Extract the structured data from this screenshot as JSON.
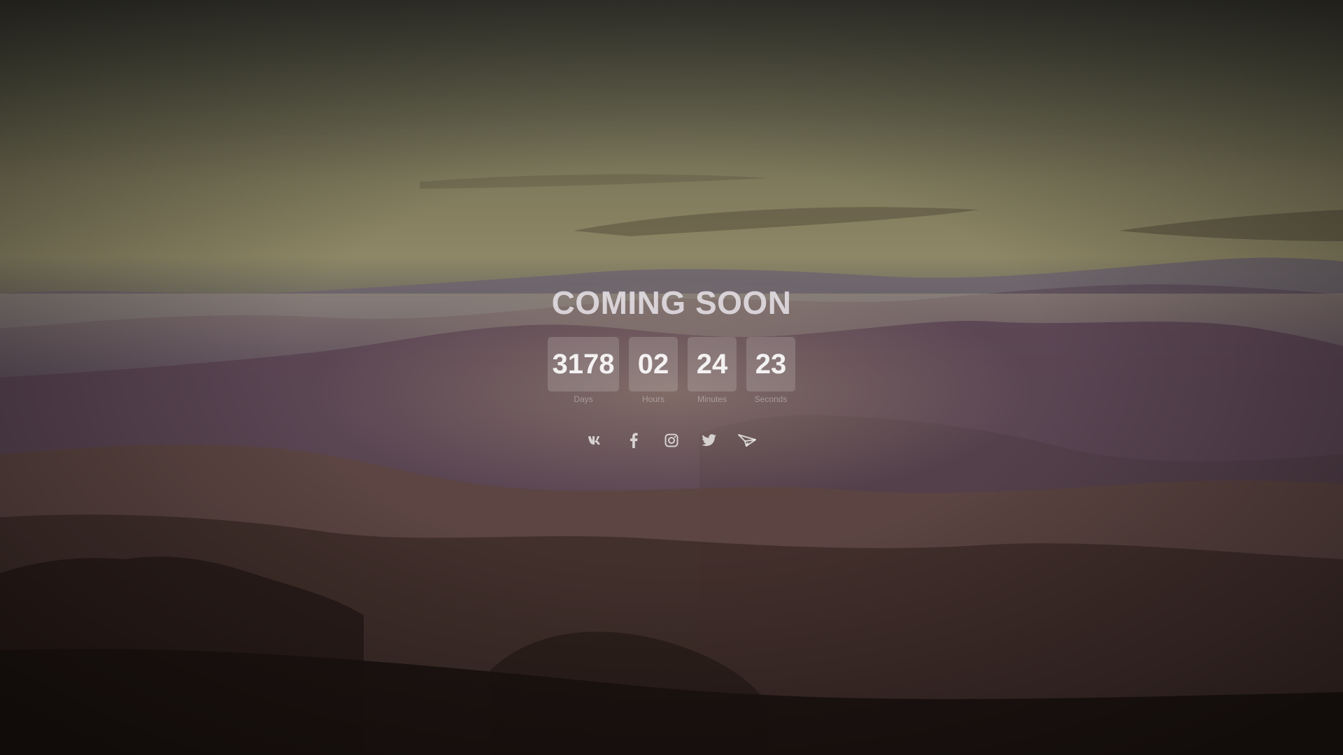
{
  "page": {
    "title": "COMING SOON"
  },
  "countdown": [
    {
      "value": "3178",
      "label": "Days"
    },
    {
      "value": "02",
      "label": "Hours"
    },
    {
      "value": "24",
      "label": "Minutes"
    },
    {
      "value": "23",
      "label": "Seconds"
    }
  ],
  "social": [
    {
      "icon": "vk-icon"
    },
    {
      "icon": "facebook-icon"
    },
    {
      "icon": "instagram-icon"
    },
    {
      "icon": "twitter-icon"
    },
    {
      "icon": "telegram-icon"
    }
  ],
  "colors": {
    "sky_top": "#3c3b33",
    "horizon": "#8e8766",
    "hills": "#5f4a52",
    "ground": "#1f1612"
  }
}
